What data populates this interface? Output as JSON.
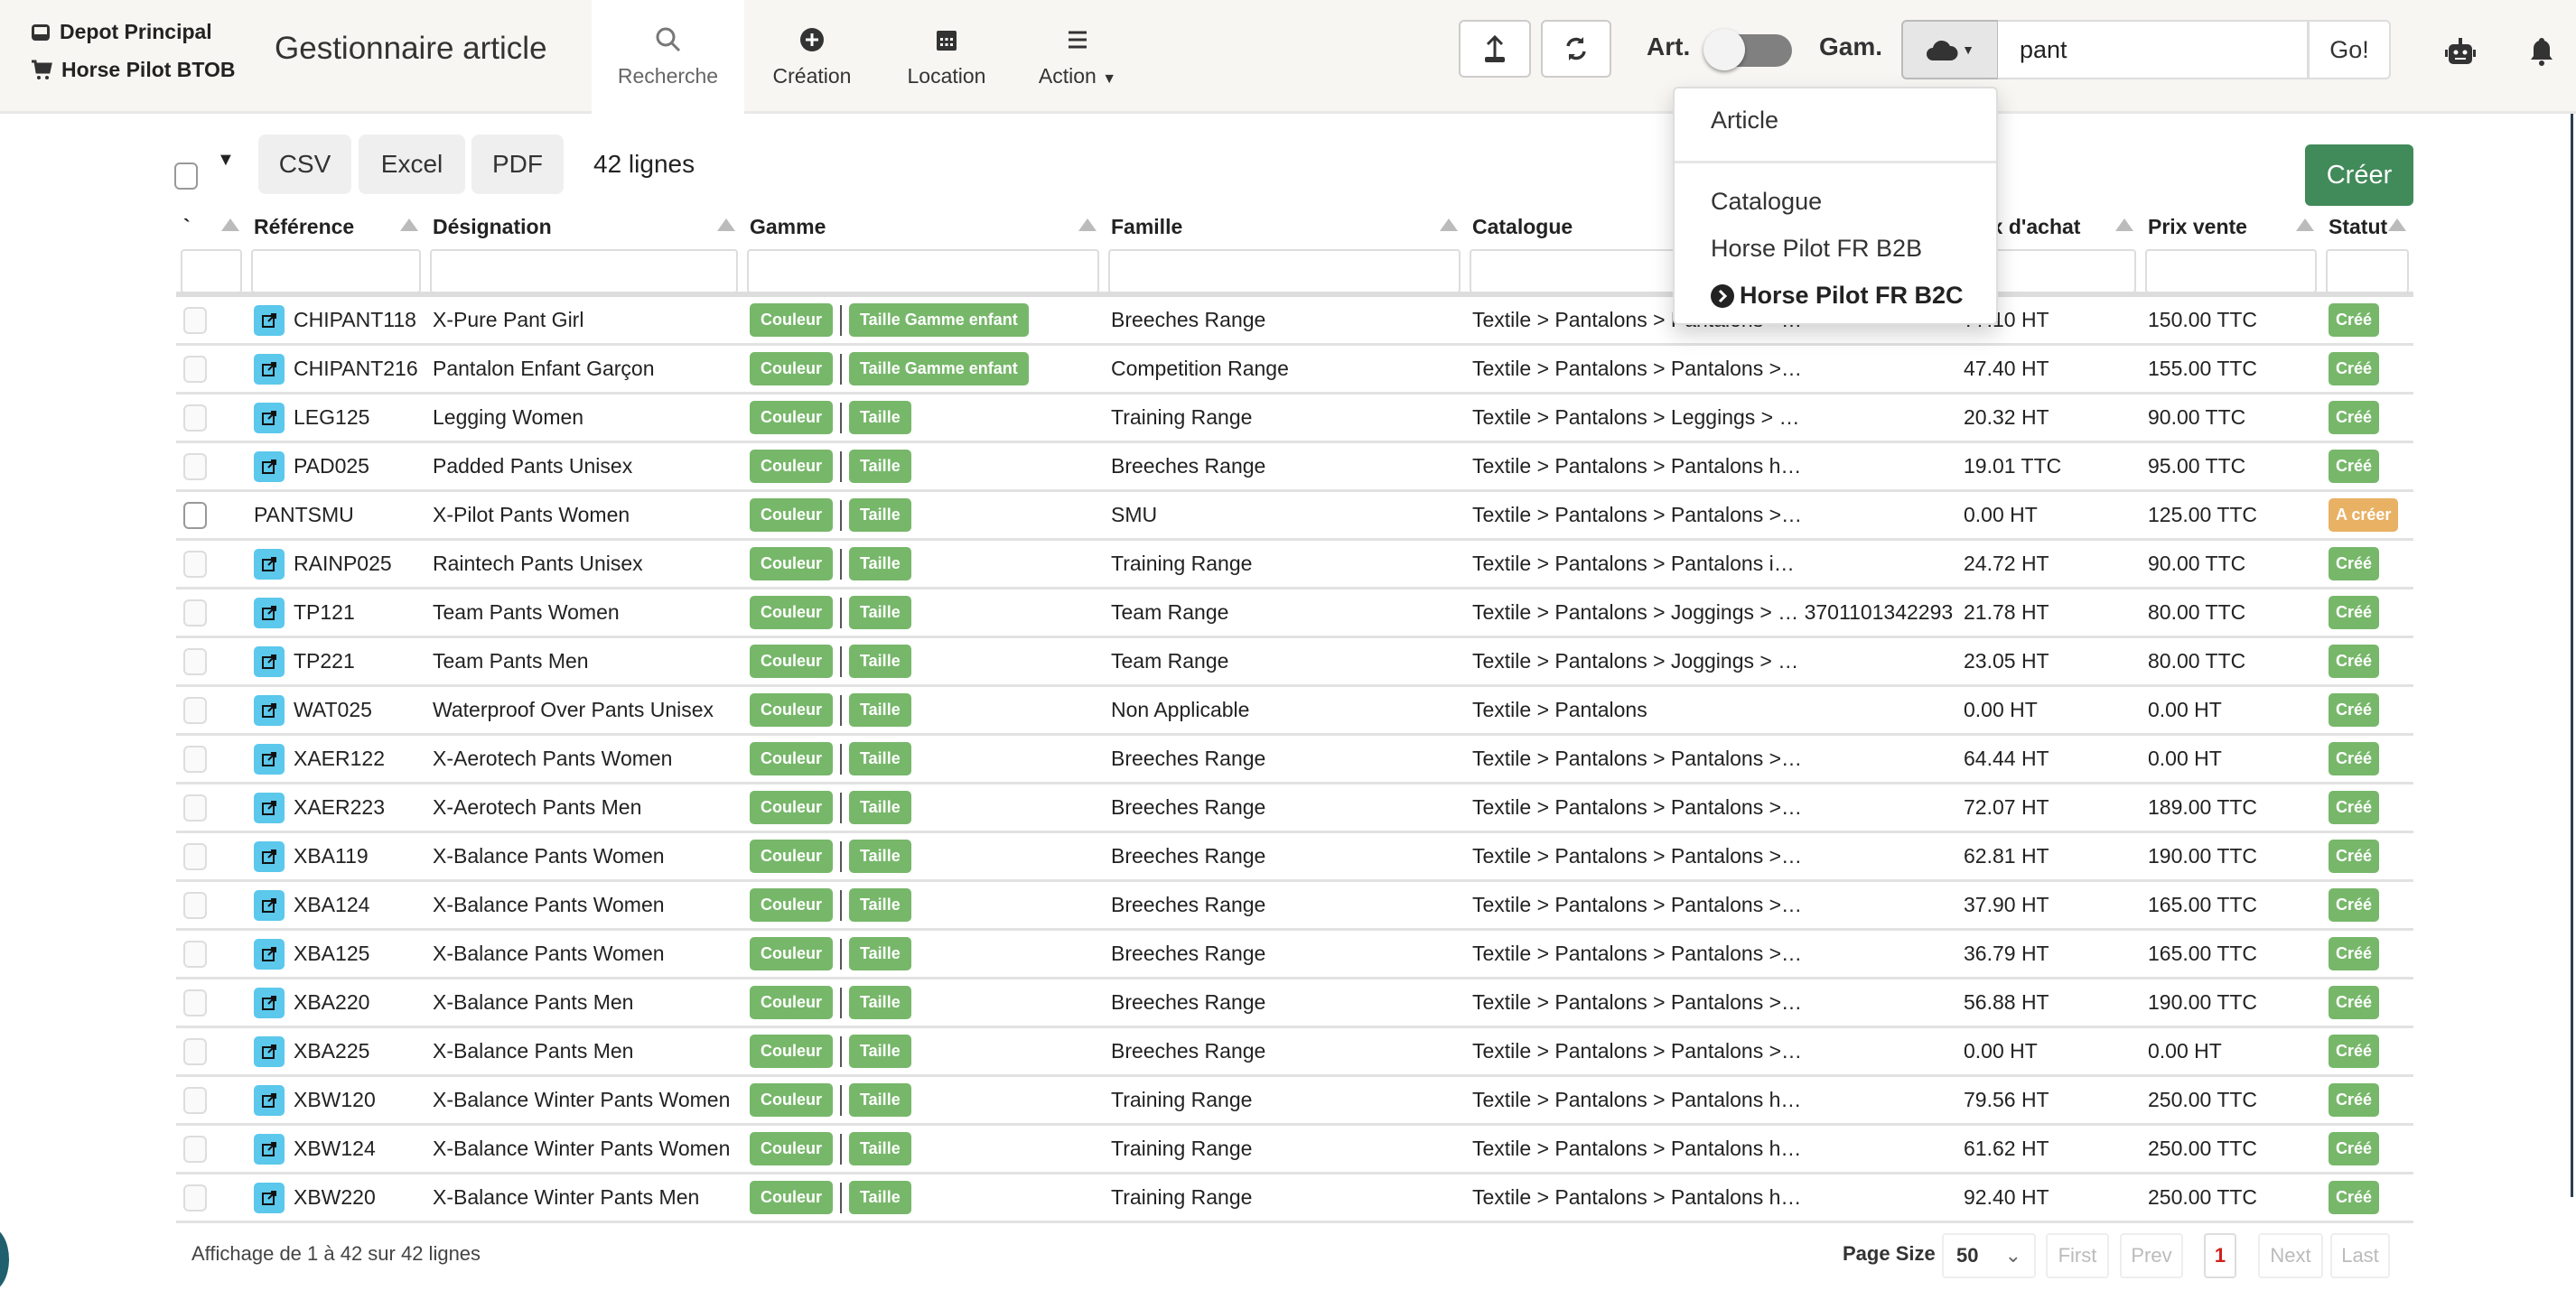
{
  "header": {
    "depot": "Depot Principal",
    "shop": "Horse Pilot BTOB",
    "title": "Gestionnaire article",
    "nav": [
      {
        "label": "Recherche",
        "icon": "search-icon"
      },
      {
        "label": "Création",
        "icon": "plus-circle-icon"
      },
      {
        "label": "Location",
        "icon": "calendar-icon"
      },
      {
        "label": "Action",
        "icon": "menu-icon"
      }
    ],
    "art_label": "Art.",
    "art_toggle_on": false,
    "gam_label": "Gam.",
    "search_value": "pant",
    "go_label": "Go!"
  },
  "dropdown": {
    "items": [
      "Article",
      "Catalogue",
      "Horse Pilot FR B2B",
      "Horse Pilot FR B2C"
    ],
    "selected": "Horse Pilot FR B2C"
  },
  "toolbar": {
    "csv": "CSV",
    "excel": "Excel",
    "pdf": "PDF",
    "count": "42 lignes",
    "create": "Créer"
  },
  "table": {
    "columns": [
      "`",
      "Référence",
      "Désignation",
      "Gamme",
      "Famille",
      "Catalogue",
      "Prix d'achat",
      "Prix vente",
      "Statut"
    ],
    "rows": [
      {
        "ref": "CHIPANT118",
        "link": true,
        "des": "X-Pure Pant Girl",
        "g1": "Couleur",
        "g2": "Taille Gamme enfant",
        "fam": "Breeches Range",
        "cat": "Textile > Pantalons > Pantalons >…",
        "pa": "77.10 HT",
        "pv": "150.00 TTC",
        "st": "Créé"
      },
      {
        "ref": "CHIPANT216",
        "link": true,
        "des": "Pantalon Enfant Garçon",
        "g1": "Couleur",
        "g2": "Taille Gamme enfant",
        "fam": "Competition Range",
        "cat": "Textile > Pantalons > Pantalons >…",
        "pa": "47.40 HT",
        "pv": "155.00 TTC",
        "st": "Créé"
      },
      {
        "ref": "LEG125",
        "link": true,
        "des": "Legging Women",
        "g1": "Couleur",
        "g2": "Taille",
        "fam": "Training Range",
        "cat": "Textile > Pantalons > Leggings > …",
        "pa": "20.32 HT",
        "pv": "90.00 TTC",
        "st": "Créé"
      },
      {
        "ref": "PAD025",
        "link": true,
        "des": "Padded Pants Unisex",
        "g1": "Couleur",
        "g2": "Taille",
        "fam": "Breeches Range",
        "cat": "Textile > Pantalons > Pantalons h…",
        "pa": "19.01 TTC",
        "pv": "95.00 TTC",
        "st": "Créé"
      },
      {
        "ref": "PANTSMU",
        "link": false,
        "des": "X-Pilot Pants Women",
        "g1": "Couleur",
        "g2": "Taille",
        "fam": "SMU",
        "cat": "Textile > Pantalons > Pantalons >…",
        "pa": "0.00 HT",
        "pv": "125.00 TTC",
        "st": "A créer"
      },
      {
        "ref": "RAINP025",
        "link": true,
        "des": "Raintech Pants Unisex",
        "g1": "Couleur",
        "g2": "Taille",
        "fam": "Training Range",
        "cat": "Textile > Pantalons > Pantalons i…",
        "pa": "24.72 HT",
        "pv": "90.00 TTC",
        "st": "Créé"
      },
      {
        "ref": "TP121",
        "link": true,
        "des": "Team Pants Women",
        "g1": "Couleur",
        "g2": "Taille",
        "fam": "Team Range",
        "cat": "Textile > Pantalons > Joggings > … 3701101342293",
        "pa": "21.78 HT",
        "pv": "80.00 TTC",
        "st": "Créé"
      },
      {
        "ref": "TP221",
        "link": true,
        "des": "Team Pants Men",
        "g1": "Couleur",
        "g2": "Taille",
        "fam": "Team Range",
        "cat": "Textile > Pantalons > Joggings > …",
        "pa": "23.05 HT",
        "pv": "80.00 TTC",
        "st": "Créé"
      },
      {
        "ref": "WAT025",
        "link": true,
        "des": "Waterproof Over Pants Unisex",
        "g1": "Couleur",
        "g2": "Taille",
        "fam": "Non Applicable",
        "cat": "Textile > Pantalons",
        "pa": "0.00 HT",
        "pv": "0.00 HT",
        "st": "Créé"
      },
      {
        "ref": "XAER122",
        "link": true,
        "des": "X-Aerotech Pants Women",
        "g1": "Couleur",
        "g2": "Taille",
        "fam": "Breeches Range",
        "cat": "Textile > Pantalons > Pantalons >…",
        "pa": "64.44 HT",
        "pv": "0.00 HT",
        "st": "Créé"
      },
      {
        "ref": "XAER223",
        "link": true,
        "des": "X-Aerotech Pants Men",
        "g1": "Couleur",
        "g2": "Taille",
        "fam": "Breeches Range",
        "cat": "Textile > Pantalons > Pantalons >…",
        "pa": "72.07 HT",
        "pv": "189.00 TTC",
        "st": "Créé"
      },
      {
        "ref": "XBA119",
        "link": true,
        "des": "X-Balance Pants Women",
        "g1": "Couleur",
        "g2": "Taille",
        "fam": "Breeches Range",
        "cat": "Textile > Pantalons > Pantalons >…",
        "pa": "62.81 HT",
        "pv": "190.00 TTC",
        "st": "Créé"
      },
      {
        "ref": "XBA124",
        "link": true,
        "des": "X-Balance Pants Women",
        "g1": "Couleur",
        "g2": "Taille",
        "fam": "Breeches Range",
        "cat": "Textile > Pantalons > Pantalons >…",
        "pa": "37.90 HT",
        "pv": "165.00 TTC",
        "st": "Créé"
      },
      {
        "ref": "XBA125",
        "link": true,
        "des": "X-Balance Pants Women",
        "g1": "Couleur",
        "g2": "Taille",
        "fam": "Breeches Range",
        "cat": "Textile > Pantalons > Pantalons >…",
        "pa": "36.79 HT",
        "pv": "165.00 TTC",
        "st": "Créé"
      },
      {
        "ref": "XBA220",
        "link": true,
        "des": "X-Balance Pants Men",
        "g1": "Couleur",
        "g2": "Taille",
        "fam": "Breeches Range",
        "cat": "Textile > Pantalons > Pantalons >…",
        "pa": "56.88 HT",
        "pv": "190.00 TTC",
        "st": "Créé"
      },
      {
        "ref": "XBA225",
        "link": true,
        "des": "X-Balance Pants Men",
        "g1": "Couleur",
        "g2": "Taille",
        "fam": "Breeches Range",
        "cat": "Textile > Pantalons > Pantalons >…",
        "pa": "0.00 HT",
        "pv": "0.00 HT",
        "st": "Créé"
      },
      {
        "ref": "XBW120",
        "link": true,
        "des": "X-Balance Winter Pants Women",
        "g1": "Couleur",
        "g2": "Taille",
        "fam": "Training Range",
        "cat": "Textile > Pantalons > Pantalons h…",
        "pa": "79.56 HT",
        "pv": "250.00 TTC",
        "st": "Créé"
      },
      {
        "ref": "XBW124",
        "link": true,
        "des": "X-Balance Winter Pants Women",
        "g1": "Couleur",
        "g2": "Taille",
        "fam": "Training Range",
        "cat": "Textile > Pantalons > Pantalons h…",
        "pa": "61.62 HT",
        "pv": "250.00 TTC",
        "st": "Créé"
      },
      {
        "ref": "XBW220",
        "link": true,
        "des": "X-Balance Winter Pants Men",
        "g1": "Couleur",
        "g2": "Taille",
        "fam": "Training Range",
        "cat": "Textile > Pantalons > Pantalons h…",
        "pa": "92.40 HT",
        "pv": "250.00 TTC",
        "st": "Créé"
      }
    ]
  },
  "footer": {
    "summary": "Affichage de 1 à 42 sur 42 lignes",
    "page_size_label": "Page Size",
    "page_size": "50",
    "first": "First",
    "prev": "Prev",
    "current_page": "1",
    "next": "Next",
    "last": "Last"
  },
  "colors": {
    "badge_green": "#77b76a",
    "badge_orange": "#e8b163",
    "create_button": "#418a59",
    "link_icon": "#5bc8ec",
    "current_page": "#d0211c"
  }
}
